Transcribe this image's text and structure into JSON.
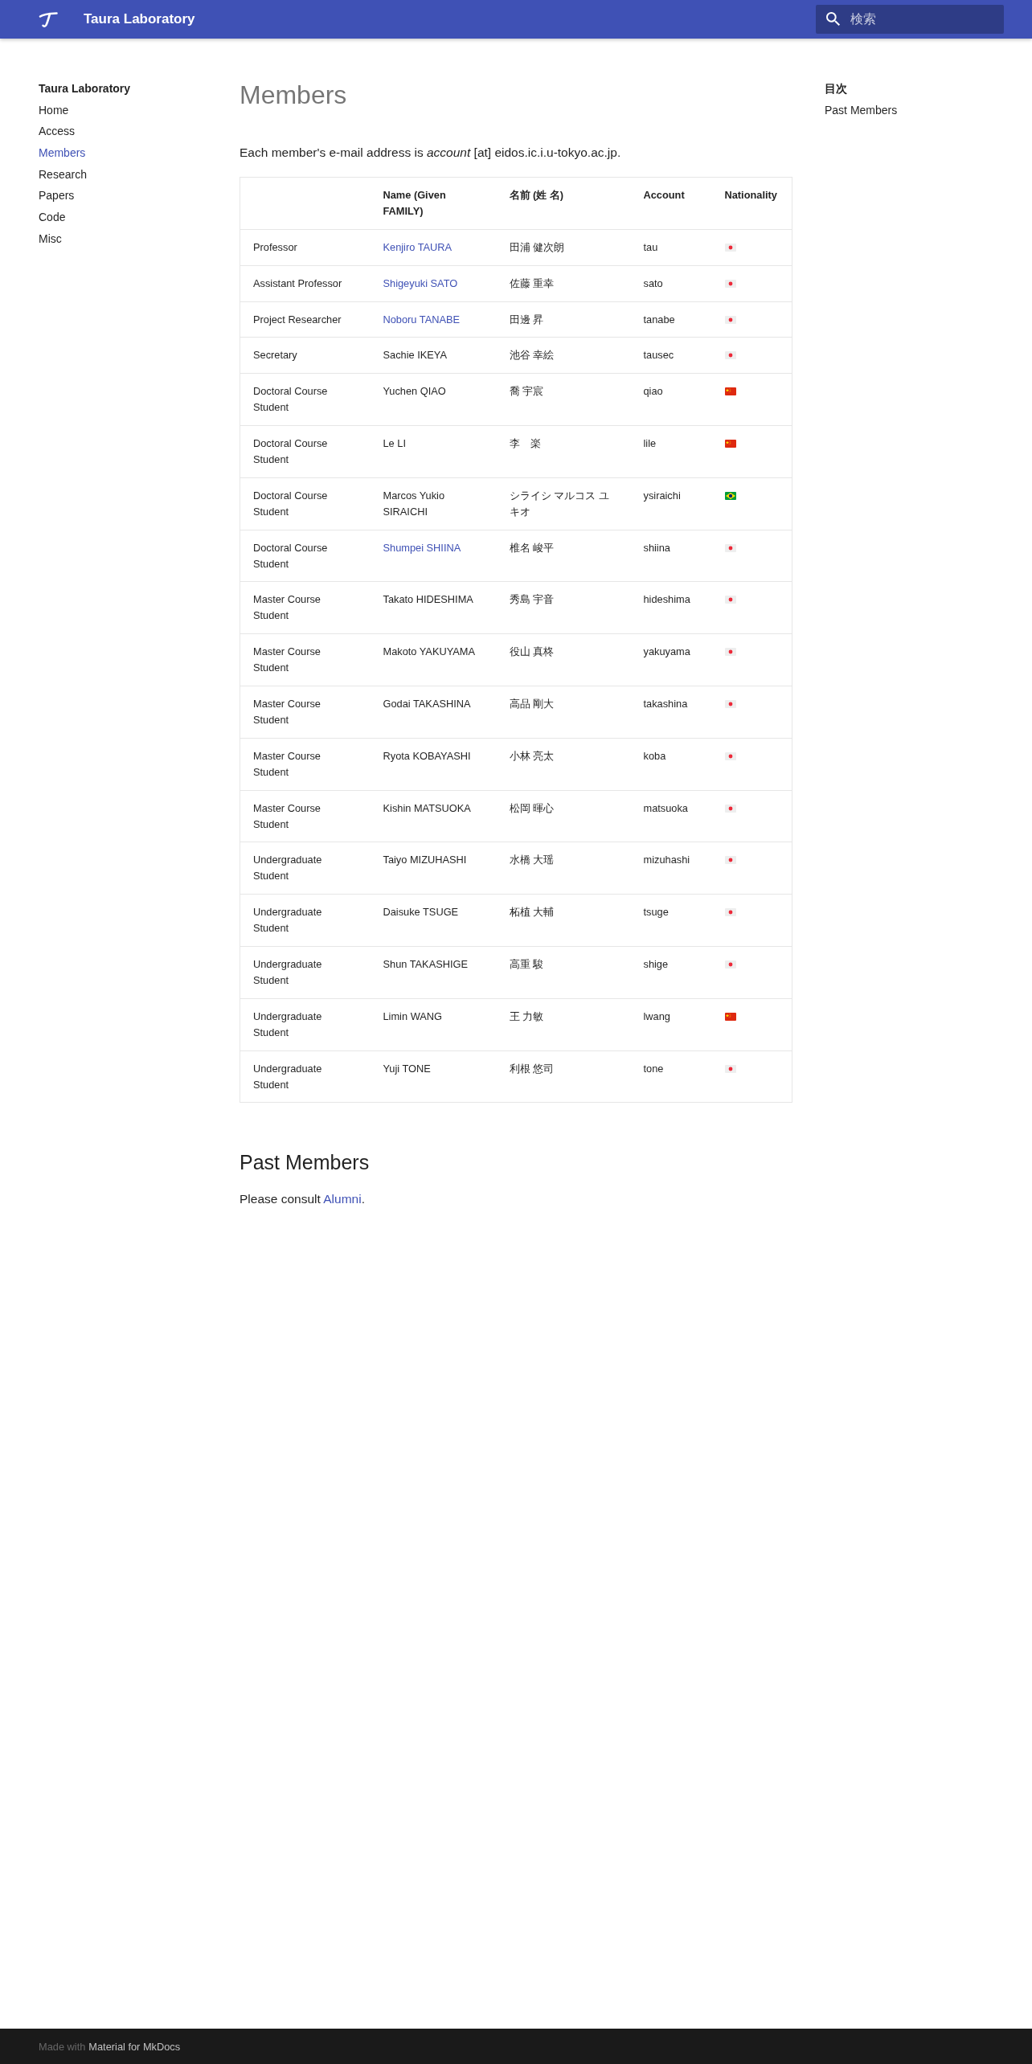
{
  "header": {
    "title": "Taura Laboratory",
    "search": {
      "placeholder": "検索"
    }
  },
  "sidebar": {
    "title": "Taura Laboratory",
    "items": [
      {
        "label": "Home",
        "selected": false
      },
      {
        "label": "Access",
        "selected": false
      },
      {
        "label": "Members",
        "selected": true
      },
      {
        "label": "Research",
        "selected": false
      },
      {
        "label": "Papers",
        "selected": false
      },
      {
        "label": "Code",
        "selected": false
      },
      {
        "label": "Misc",
        "selected": false
      }
    ]
  },
  "content": {
    "title": "Members",
    "intro": "Each member's e-mail address is *account* [at] eidos.ic.i.u-tokyo.ac.jp.",
    "table": {
      "columns": [
        "Name (Given FAMILY)",
        "名前 (姓 名)",
        "Account",
        "Nationality"
      ],
      "rows": [
        {
          "position": "Professor",
          "name": "Kenjiro TAURA",
          "linked": true,
          "name_ja": "田浦 健次朗",
          "account": "tau",
          "nationality": {
            "kind": "japan"
          }
        },
        {
          "position": "Assistant Professor",
          "name": "Shigeyuki SATO",
          "linked": true,
          "name_ja": "佐藤 重幸",
          "account": "sato",
          "nationality": {
            "kind": "japan"
          }
        },
        {
          "position": "Project Researcher",
          "name": "Noboru TANABE",
          "linked": true,
          "name_ja": "田邊 昇",
          "account": "tanabe",
          "nationality": {
            "kind": "japan"
          }
        },
        {
          "position": "Secretary",
          "name": "Sachie IKEYA",
          "linked": false,
          "name_ja": "池谷 幸絵",
          "account": "tausec",
          "nationality": {
            "kind": "japan"
          }
        },
        {
          "position": "Doctoral Course Student",
          "name": "Yuchen QIAO",
          "linked": false,
          "name_ja": "喬 宇宸",
          "account": "qiao",
          "nationality": {
            "kind": "china"
          }
        },
        {
          "position": "Doctoral Course Student",
          "name": "Le LI",
          "linked": false,
          "name_ja": "李　楽",
          "account": "lile",
          "nationality": {
            "kind": "china"
          }
        },
        {
          "position": "Doctoral Course Student",
          "name": "Marcos Yukio SIRAICHI",
          "linked": false,
          "name_ja": "シライシ マルコス ユキオ",
          "account": "ysiraichi",
          "nationality": {
            "kind": "brazil"
          }
        },
        {
          "position": "Doctoral Course Student",
          "name": "Shumpei SHIINA",
          "linked": true,
          "name_ja": "椎名 峻平",
          "account": "shiina",
          "nationality": {
            "kind": "japan"
          }
        },
        {
          "position": "Master Course Student",
          "name": "Takato HIDESHIMA",
          "linked": false,
          "name_ja": "秀島 宇音",
          "account": "hideshima",
          "nationality": {
            "kind": "japan"
          }
        },
        {
          "position": "Master Course Student",
          "name": "Makoto YAKUYAMA",
          "linked": false,
          "name_ja": "役山 真柊",
          "account": "yakuyama",
          "nationality": {
            "kind": "japan"
          }
        },
        {
          "position": "Master Course Student",
          "name": "Godai TAKASHINA",
          "linked": false,
          "name_ja": "高品 剛大",
          "account": "takashina",
          "nationality": {
            "kind": "japan"
          }
        },
        {
          "position": "Master Course Student",
          "name": "Ryota KOBAYASHI",
          "linked": false,
          "name_ja": "小林 亮太",
          "account": "koba",
          "nationality": {
            "kind": "japan"
          }
        },
        {
          "position": "Master Course Student",
          "name": "Kishin MATSUOKA",
          "linked": false,
          "name_ja": "松岡 暉心",
          "account": "matsuoka",
          "nationality": {
            "kind": "japan"
          }
        },
        {
          "position": "Undergraduate Student",
          "name": "Taiyo MIZUHASHI",
          "linked": false,
          "name_ja": "水橋 大瑶",
          "account": "mizuhashi",
          "nationality": {
            "kind": "japan"
          }
        },
        {
          "position": "Undergraduate Student",
          "name": "Daisuke TSUGE",
          "linked": false,
          "name_ja": "柘植 大輔",
          "account": "tsuge",
          "nationality": {
            "kind": "japan"
          }
        },
        {
          "position": "Undergraduate Student",
          "name": "Shun TAKASHIGE",
          "linked": false,
          "name_ja": "高重 駿",
          "account": "shige",
          "nationality": {
            "kind": "japan"
          }
        },
        {
          "position": "Undergraduate Student",
          "name": "Limin WANG",
          "linked": false,
          "name_ja": "王 力敏",
          "account": "lwang",
          "nationality": {
            "kind": "china"
          }
        },
        {
          "position": "Undergraduate Student",
          "name": "Yuji TONE",
          "linked": false,
          "name_ja": "利根 悠司",
          "account": "tone",
          "nationality": {
            "kind": "japan"
          }
        }
      ]
    },
    "past_members": {
      "title": "Past Members",
      "text": "Please consult ",
      "link": "Alumni",
      "suffix": "."
    }
  },
  "toc": {
    "title": "目次",
    "items": [
      "Past Members"
    ]
  },
  "footer": {
    "text": "Made with",
    "link": "Material for MkDocs"
  }
}
